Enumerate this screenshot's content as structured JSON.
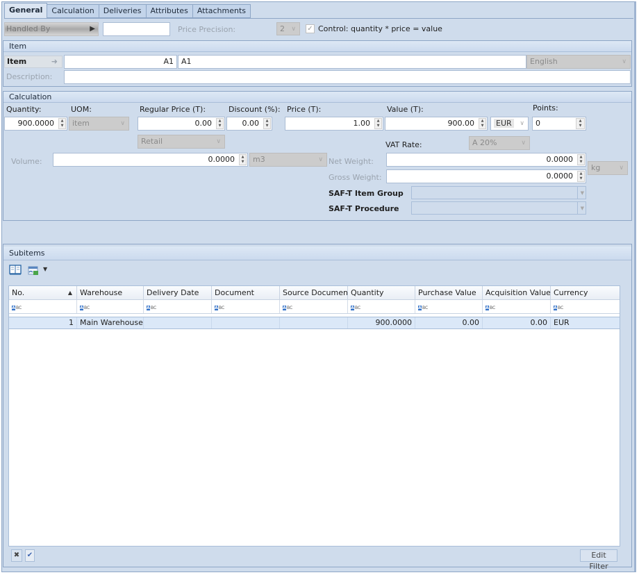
{
  "tabs": [
    {
      "label": "General",
      "active": true
    },
    {
      "label": "Calculation",
      "active": false
    },
    {
      "label": "Deliveries",
      "active": false
    },
    {
      "label": "Attributes",
      "active": false
    },
    {
      "label": "Attachments",
      "active": false
    }
  ],
  "header": {
    "handled_by_label": "Handled By",
    "handled_by_value": "",
    "price_precision_label": "Price Precision:",
    "price_precision_value": "2",
    "control_checkbox_label": "Control: quantity * price = value",
    "control_checked": true
  },
  "item_group": {
    "title": "Item",
    "item_button_label": "Item",
    "item_code": "A1",
    "item_name": "A1",
    "language": "English",
    "description_label": "Description:",
    "description_value": ""
  },
  "calculation_group": {
    "title": "Calculation",
    "quantity_label": "Quantity:",
    "quantity_value": "900.0000",
    "uom_label": "UOM:",
    "uom_value": "item",
    "regular_price_label": "Regular Price (T):",
    "regular_price_value": "0.00",
    "price_list_value": "Retail",
    "discount_label": "Discount (%):",
    "discount_value": "0.00",
    "price_label": "Price (T):",
    "price_value": "1.00",
    "value_label": "Value (T):",
    "value_value": "900.00",
    "currency_value": "EUR",
    "points_label": "Points:",
    "points_value": "0",
    "vat_rate_label": "VAT Rate:",
    "vat_rate_value": "A 20%",
    "volume_label": "Volume:",
    "volume_value": "0.0000",
    "volume_unit": "m3",
    "net_weight_label": "Net Weight:",
    "net_weight_value": "0.0000",
    "gross_weight_label": "Gross Weight:",
    "gross_weight_value": "0.0000",
    "weight_unit": "kg",
    "saft_item_group_label": "SAF-T Item Group",
    "saft_item_group_value": "",
    "saft_procedure_label": "SAF-T Procedure",
    "saft_procedure_value": ""
  },
  "subitems": {
    "title": "Subitems",
    "toolbar_icons": [
      "book-icon",
      "export-icon",
      "dropdown-arrow-icon"
    ],
    "columns": [
      "No.",
      "Warehouse",
      "Delivery Date",
      "Document",
      "Source Document",
      "Quantity",
      "Purchase Value",
      "Acquisition Value",
      "Currency"
    ],
    "filter_placeholder": "ABC",
    "rows": [
      {
        "no": "1",
        "warehouse": "Main Warehouse",
        "delivery_date": "",
        "document": "",
        "source_document": "",
        "quantity": "900.0000",
        "purchase_value": "0.00",
        "acquisition_value": "0.00",
        "currency": "EUR"
      }
    ],
    "footer": {
      "clear_filter_icon": "close-icon",
      "apply_filter_icon": "check-icon",
      "edit_filter_label": "Edit Filter"
    }
  }
}
